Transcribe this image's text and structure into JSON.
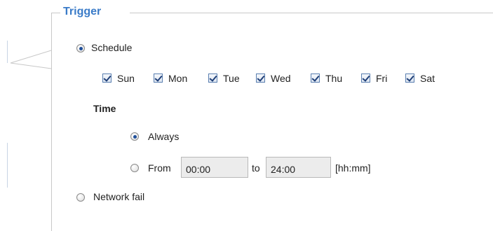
{
  "trigger": {
    "legend": "Trigger",
    "schedule": {
      "label": "Schedule",
      "selected": true,
      "days": [
        {
          "label": "Sun",
          "checked": true
        },
        {
          "label": "Mon",
          "checked": true
        },
        {
          "label": "Tue",
          "checked": true
        },
        {
          "label": "Wed",
          "checked": true
        },
        {
          "label": "Thu",
          "checked": true
        },
        {
          "label": "Fri",
          "checked": true
        },
        {
          "label": "Sat",
          "checked": true
        }
      ],
      "time": {
        "heading": "Time",
        "always_label": "Always",
        "always_selected": true,
        "from_label": "From",
        "from_value": "00:00",
        "to_label": "to",
        "to_value": "24:00",
        "format_hint": "[hh:mm]"
      }
    },
    "network_fail": {
      "label": "Network fail",
      "selected": false
    }
  },
  "colors": {
    "legend": "#3a7bc8",
    "radio_dot": "#1f4f9a",
    "input_bg": "#ececec"
  }
}
